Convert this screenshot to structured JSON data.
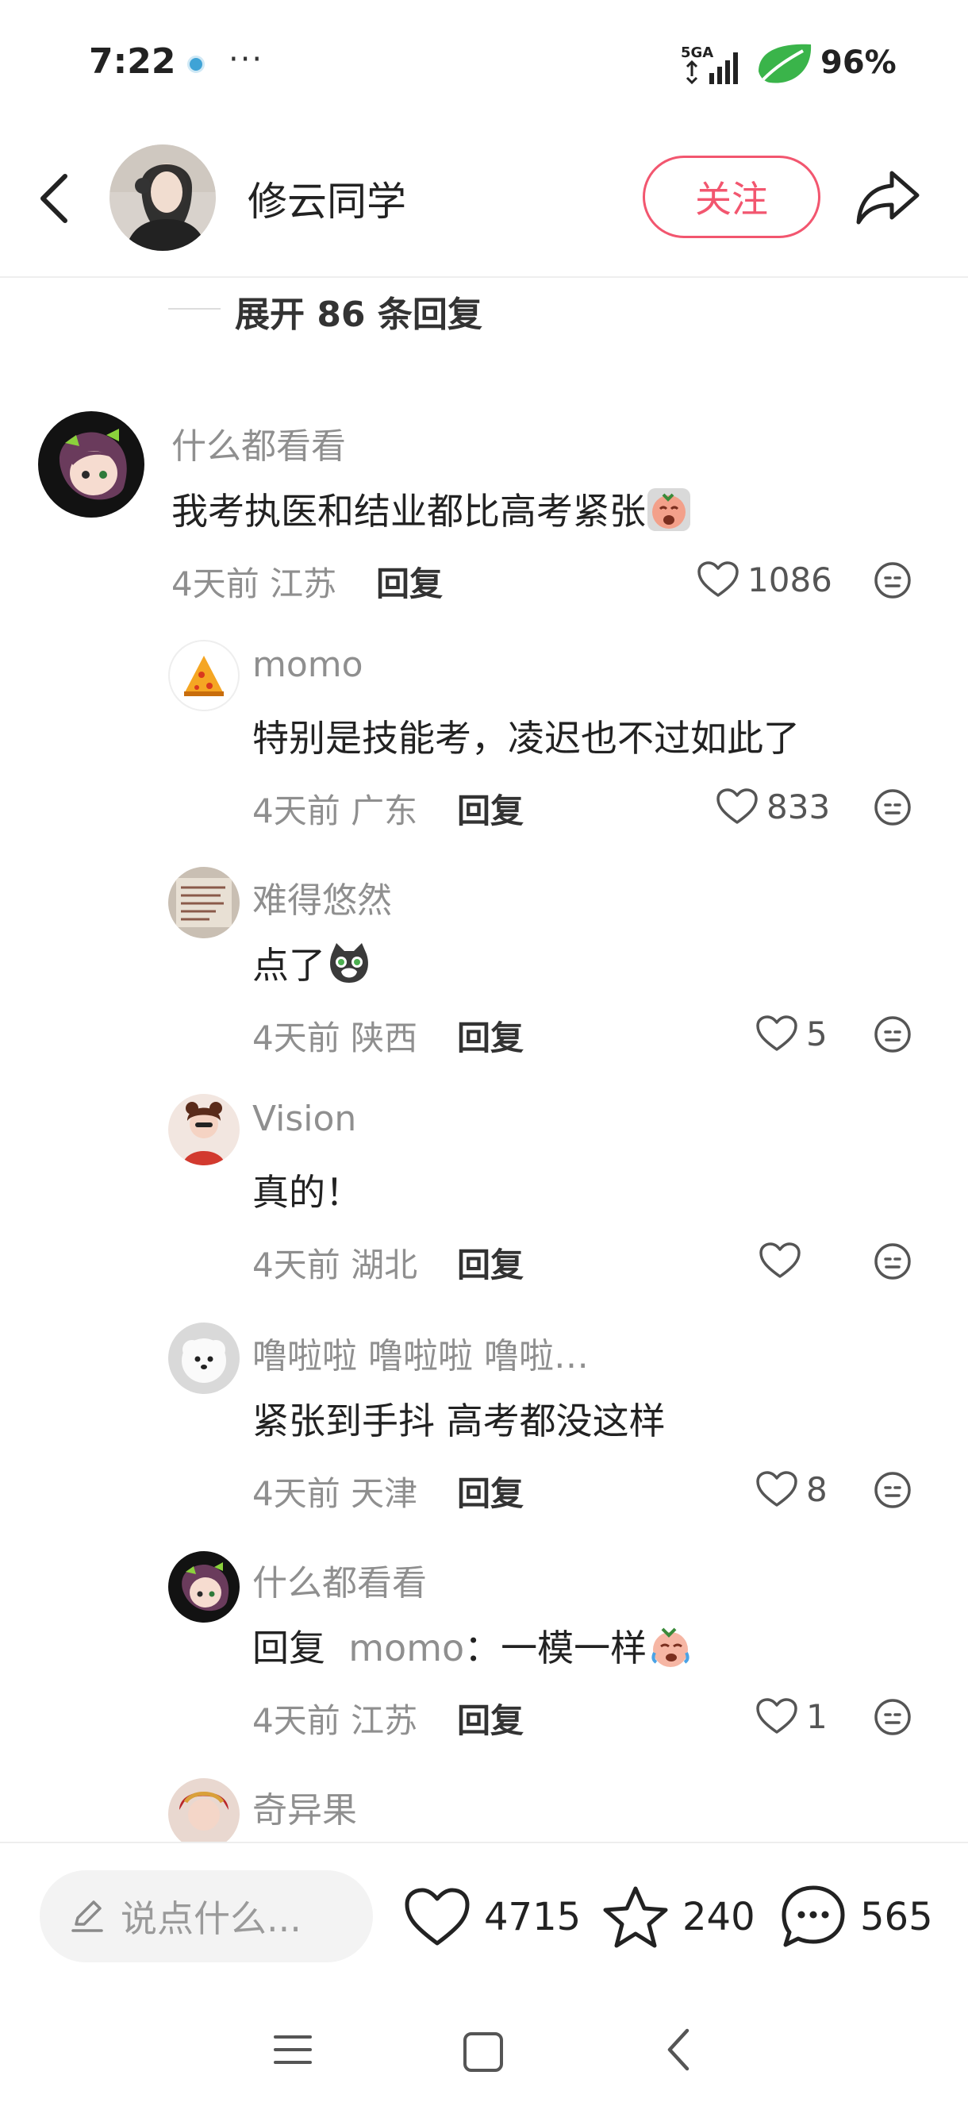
{
  "status_bar": {
    "time": "7:22",
    "more": "···",
    "network": "5GA",
    "battery": "96%"
  },
  "header": {
    "author_name": "修云同学",
    "follow_label": "关注"
  },
  "thread": {
    "expand_label": "展开 86 条回复"
  },
  "comments": [
    {
      "user": "什么都看看",
      "text": "我考执医和结业都比高考紧张",
      "time": "4天前",
      "location": "江苏",
      "reply_label": "回复",
      "likes": "1086"
    },
    {
      "user": "momo",
      "text": "特别是技能考，凌迟也不过如此了",
      "time": "4天前",
      "location": "广东",
      "reply_label": "回复",
      "likes": "833"
    },
    {
      "user": "难得悠然",
      "text": "点了",
      "time": "4天前",
      "location": "陕西",
      "reply_label": "回复",
      "likes": "5"
    },
    {
      "user": "Vision",
      "text": "真的！",
      "time": "4天前",
      "location": "湖北",
      "reply_label": "回复",
      "likes": ""
    },
    {
      "user": "噜啦啦 噜啦啦 噜啦…",
      "text": "紧张到手抖 高考都没这样",
      "time": "4天前",
      "location": "天津",
      "reply_label": "回复",
      "likes": "8"
    },
    {
      "user": "什么都看看",
      "text_prefix": "回复",
      "reply_to": "momo",
      "text": "：一模一样",
      "time": "4天前",
      "location": "江苏",
      "reply_label": "回复",
      "likes": "1"
    },
    {
      "user": "奇异果"
    }
  ],
  "bottom_bar": {
    "input_placeholder": "说点什么...",
    "likes": "4715",
    "stars": "240",
    "comments": "565"
  },
  "icons": {
    "accent": "#f2566f"
  }
}
